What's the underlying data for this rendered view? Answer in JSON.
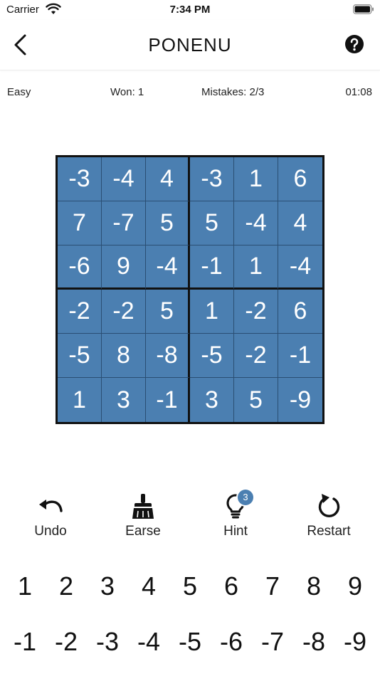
{
  "status_bar": {
    "carrier": "Carrier",
    "time": "7:34 PM"
  },
  "nav": {
    "title": "PONENU",
    "back_icon": "chevron-left-icon",
    "help_icon": "question-circle-icon"
  },
  "stats": {
    "level": "Easy",
    "won": "Won: 1",
    "mistakes": "Mistakes: 2/3",
    "timer": "01:08"
  },
  "board": {
    "cell_color": "#4b7fb1",
    "rows": [
      [
        "-3",
        "-4",
        "4",
        "-3",
        "1",
        "6"
      ],
      [
        "7",
        "-7",
        "5",
        "5",
        "-4",
        "4"
      ],
      [
        "-6",
        "9",
        "-4",
        "-1",
        "1",
        "-4"
      ],
      [
        "-2",
        "-2",
        "5",
        "1",
        "-2",
        "6"
      ],
      [
        "-5",
        "8",
        "-8",
        "-5",
        "-2",
        "-1"
      ],
      [
        "1",
        "3",
        "-1",
        "3",
        "5",
        "-9"
      ]
    ]
  },
  "tools": {
    "undo": {
      "label": "Undo",
      "icon": "undo-icon"
    },
    "erase": {
      "label": "Earse",
      "icon": "brush-icon"
    },
    "hint": {
      "label": "Hint",
      "icon": "lightbulb-icon",
      "count": "3"
    },
    "restart": {
      "label": "Restart",
      "icon": "restart-icon"
    }
  },
  "keypad": {
    "positive": [
      "1",
      "2",
      "3",
      "4",
      "5",
      "6",
      "7",
      "8",
      "9"
    ],
    "negative": [
      "-1",
      "-2",
      "-3",
      "-4",
      "-5",
      "-6",
      "-7",
      "-8",
      "-9"
    ]
  }
}
